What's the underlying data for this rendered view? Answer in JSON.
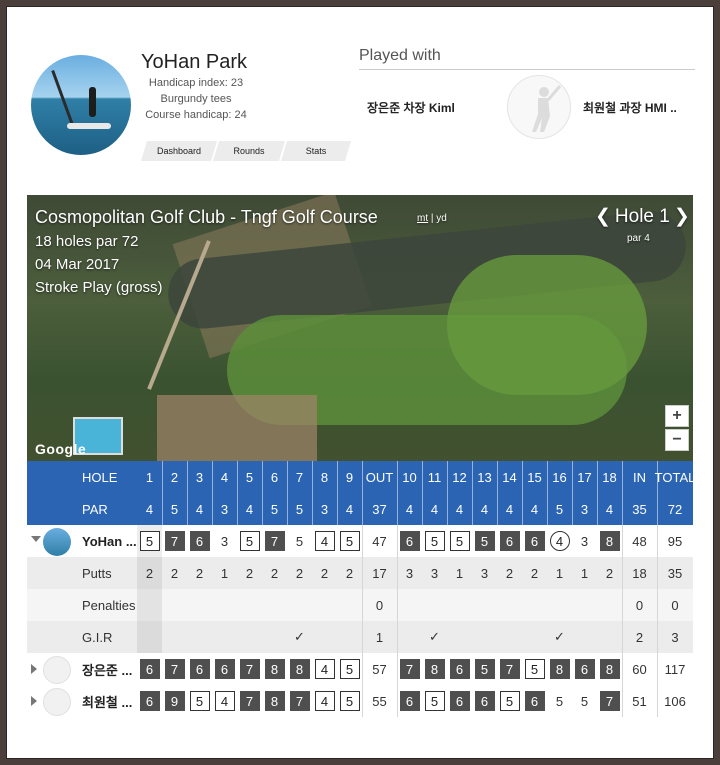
{
  "profile": {
    "name": "YoHan Park",
    "handicap_index": "Handicap index: 23",
    "tees": "Burgundy tees",
    "course_handicap": "Course handicap: 24",
    "tabs": [
      "Dashboard",
      "Rounds",
      "Stats"
    ]
  },
  "played_with": {
    "title": "Played with",
    "friend1": "장은준 차장 Kiml",
    "friend2": "최원철 과장 HMI .."
  },
  "map": {
    "course_name": "Cosmopolitan Golf Club - Tngf Golf Course",
    "units_active": "mt",
    "units_sep": " | ",
    "units_other": "yd",
    "holes_par": "18 holes par 72",
    "date": "04 Mar 2017",
    "play_mode": "Stroke Play (gross)",
    "hole_prev": "❮",
    "hole_label": "Hole 1",
    "hole_next": "❯",
    "hole_par": "par 4",
    "zoom_in": "+",
    "zoom_out": "−",
    "google": "Google"
  },
  "scorecard": {
    "hole_label": "HOLE",
    "par_label": "PAR",
    "holes": [
      "1",
      "2",
      "3",
      "4",
      "5",
      "6",
      "7",
      "8",
      "9",
      "OUT",
      "10",
      "11",
      "12",
      "13",
      "14",
      "15",
      "16",
      "17",
      "18",
      "IN",
      "TOTAL"
    ],
    "par": [
      "4",
      "5",
      "4",
      "3",
      "4",
      "5",
      "5",
      "3",
      "4",
      "37",
      "4",
      "4",
      "4",
      "4",
      "4",
      "4",
      "5",
      "3",
      "4",
      "35",
      "72"
    ],
    "player": {
      "name": "YoHan ...",
      "scores": [
        "5",
        "7",
        "6",
        "3",
        "5",
        "7",
        "5",
        "4",
        "5",
        "47",
        "6",
        "5",
        "5",
        "5",
        "6",
        "6",
        "4",
        "3",
        "8",
        "48",
        "95"
      ],
      "styles": [
        "box",
        "dark",
        "dark",
        "plain",
        "box",
        "dark",
        "plain",
        "box",
        "box",
        "plain",
        "dark",
        "box",
        "box",
        "dark",
        "dark",
        "dark",
        "circle",
        "plain",
        "dark",
        "plain",
        "plain"
      ]
    },
    "putts_label": "Putts",
    "putts": [
      "2",
      "2",
      "2",
      "1",
      "2",
      "2",
      "2",
      "2",
      "2",
      "17",
      "3",
      "3",
      "1",
      "3",
      "2",
      "2",
      "1",
      "1",
      "2",
      "18",
      "35"
    ],
    "penalties_label": "Penalties",
    "penalties": [
      "",
      "",
      "",
      "",
      "",
      "",
      "",
      "",
      "",
      "0",
      "",
      "",
      "",
      "",
      "",
      "",
      "",
      "",
      "",
      "0",
      "0"
    ],
    "gir_label": "G.I.R",
    "gir": [
      "",
      "",
      "",
      "",
      "",
      "",
      "✓",
      "",
      "",
      "1",
      "",
      "✓",
      "",
      "",
      "",
      "",
      "✓",
      "",
      "",
      "2",
      "3"
    ],
    "friend1": {
      "name": "장은준 ...",
      "scores": [
        "6",
        "7",
        "6",
        "6",
        "7",
        "8",
        "8",
        "4",
        "5",
        "57",
        "7",
        "8",
        "6",
        "5",
        "7",
        "5",
        "8",
        "6",
        "8",
        "60",
        "117"
      ],
      "styles": [
        "dark",
        "dark",
        "dark",
        "dark",
        "dark",
        "dark",
        "dark",
        "box",
        "box",
        "plain",
        "dark",
        "dark",
        "dark",
        "dark",
        "dark",
        "box",
        "dark",
        "dark",
        "dark",
        "plain",
        "plain"
      ]
    },
    "friend2": {
      "name": "최원철 ...",
      "scores": [
        "6",
        "9",
        "5",
        "4",
        "7",
        "8",
        "7",
        "4",
        "5",
        "55",
        "6",
        "5",
        "6",
        "6",
        "5",
        "6",
        "5",
        "5",
        "7",
        "51",
        "106"
      ],
      "styles": [
        "dark",
        "dark",
        "box",
        "box",
        "dark",
        "dark",
        "dark",
        "box",
        "box",
        "plain",
        "dark",
        "box",
        "dark",
        "dark",
        "box",
        "dark",
        "plain",
        "plain",
        "dark",
        "plain",
        "plain"
      ]
    }
  }
}
